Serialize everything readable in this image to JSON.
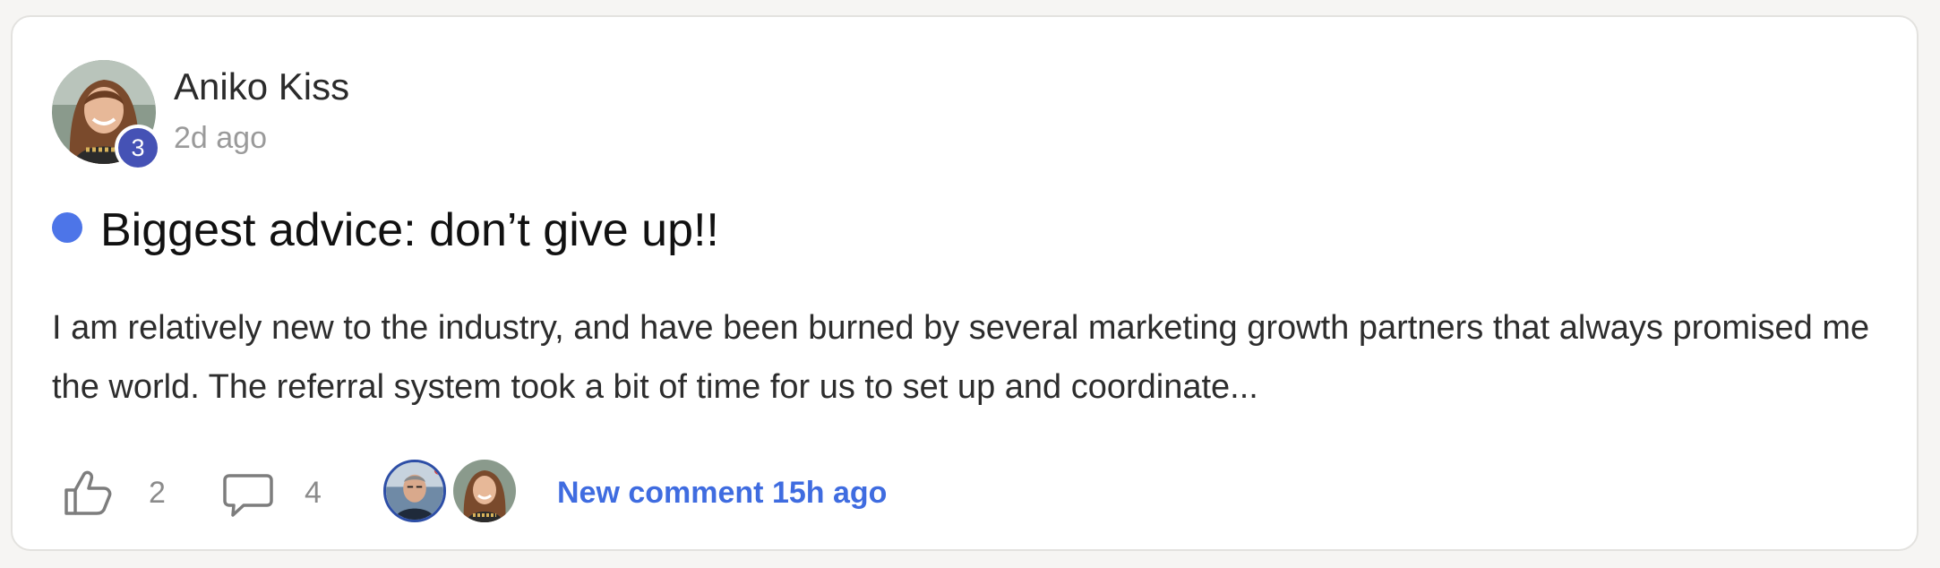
{
  "post": {
    "author": {
      "name": "Aniko Kiss",
      "level": "3",
      "avatar_icon": "user-avatar-photo"
    },
    "posted_ago": "2d ago",
    "title": "Biggest advice: don’t give up!!",
    "unread_dot_color": "#4d75e8",
    "excerpt": "I am relatively new to the industry, and have been burned by several marketing growth partners that always promised me the world. The referral system took a bit of time for us to set up and coordinate...",
    "likes": "2",
    "comments": "4",
    "new_comment_label": "New comment 15h ago",
    "accent_color": "#3f6ce0",
    "level_badge_color": "#4552b5"
  }
}
